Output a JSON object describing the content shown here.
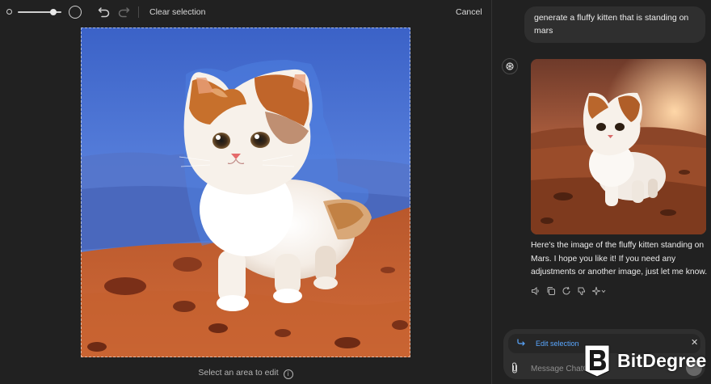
{
  "toolbar": {
    "brush_size": 0.88,
    "clear_selection": "Clear selection",
    "cancel": "Cancel"
  },
  "editor": {
    "hint": "Select an area to edit",
    "hint_icon": "info-icon"
  },
  "chat": {
    "user_message": "generate a fluffy kitten that is standing on mars",
    "assistant_message": "Here's the image of the fluffy kitten standing on Mars. I hope you like it! If you need any adjustments or another image, just let me know.",
    "actions": [
      "speaker-icon",
      "copy-icon",
      "regenerate-icon",
      "thumbs-down-icon",
      "sparkle-model-icon"
    ]
  },
  "composer": {
    "edit_selection_label": "Edit selection",
    "placeholder": "Message ChatGPT"
  },
  "watermark": {
    "text": "BitDegree"
  },
  "colors": {
    "background": "#212121",
    "panel": "#2f2f2f",
    "accent_link": "#5aa7ff",
    "selection_mask": "#4f7fe0",
    "mars_ground": "#c05a2e"
  }
}
